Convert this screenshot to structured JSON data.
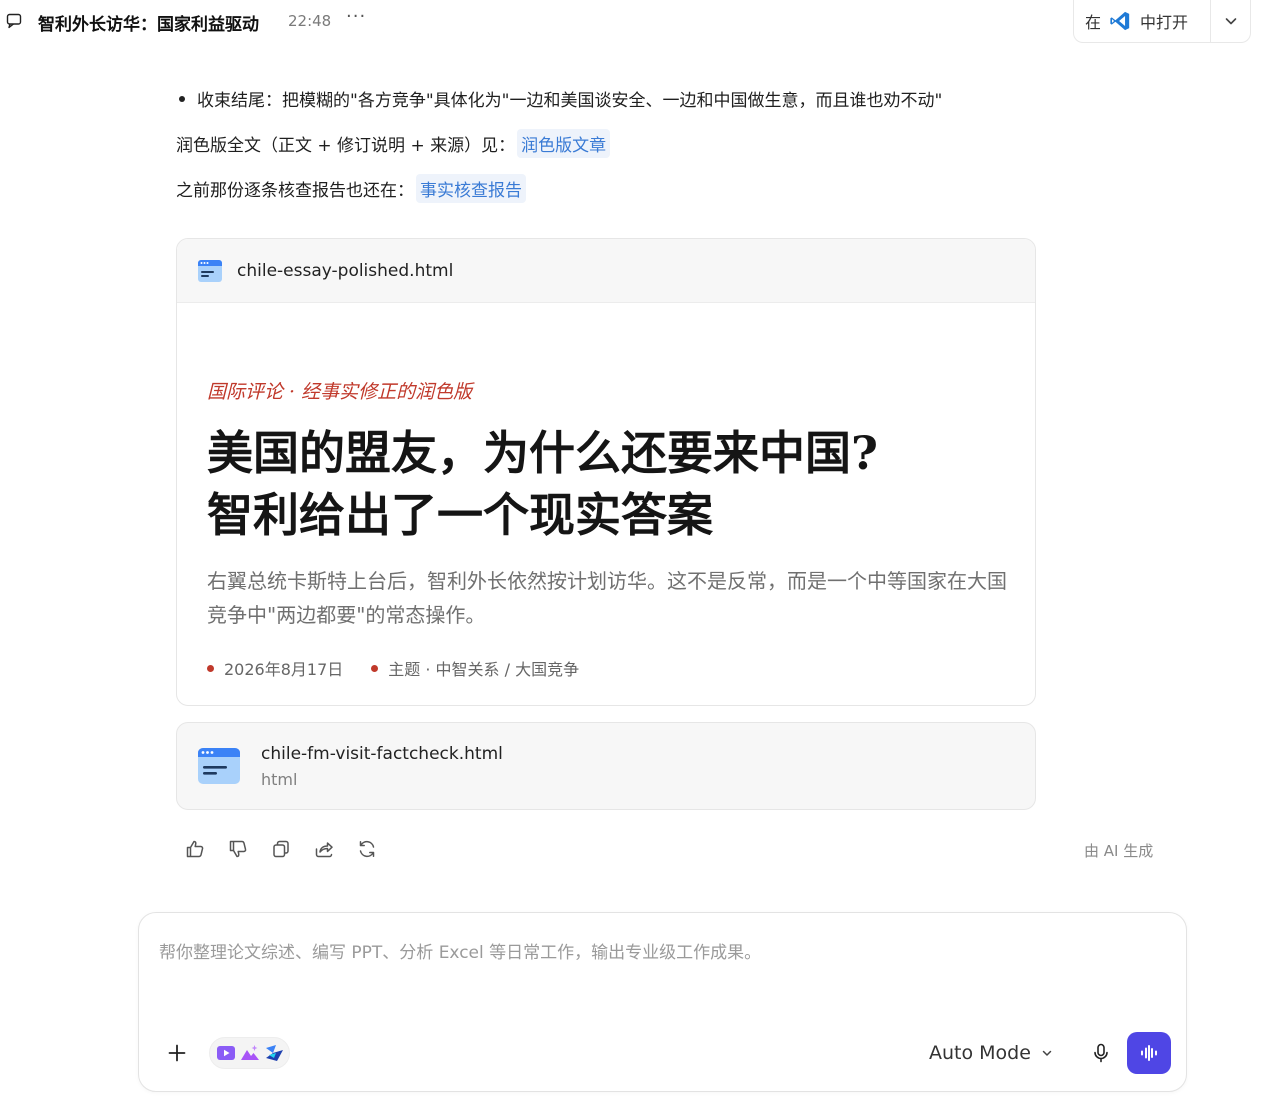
{
  "header": {
    "title": "智利外长访华：国家利益驱动",
    "time": "22:48",
    "more_label": "···",
    "open_prefix": "在",
    "open_suffix": "中打开",
    "open_app_icon": "vscode-icon"
  },
  "message": {
    "bullet": "收束结尾：把模糊的\"各方竞争\"具体化为\"一边和美国谈安全、一边和中国做生意，而且谁也劝不动\"",
    "ref1_text": "润色版全文（正文 + 修订说明 + 来源）见：",
    "ref1_link": "润色版文章",
    "ref2_text": "之前那份逐条核查报告也还在：",
    "ref2_link": "事实核查报告"
  },
  "card1": {
    "filename": "chile-essay-polished.html",
    "kicker": "国际评论 · 经事实修正的润色版",
    "headline_line1": "美国的盟友，为什么还要来中国?",
    "headline_line2": "智利给出了一个现实答案",
    "dek": "右翼总统卡斯特上台后，智利外长依然按计划访华。这不是反常，而是一个中等国家在大国竞争中\"两边都要\"的常态操作。",
    "meta_date": "2026年8月17日",
    "meta_topic": "主题 · 中智关系 / 大国竞争",
    "accent_color": "#c0392b"
  },
  "card2": {
    "filename": "chile-fm-visit-factcheck.html",
    "filetype": "html"
  },
  "actions": {
    "icons": [
      "thumbs-up-icon",
      "thumbs-down-icon",
      "copy-icon",
      "share-icon",
      "regenerate-icon"
    ],
    "ai_label": "由 AI 生成"
  },
  "composer": {
    "placeholder": "帮你整理论文综述、编写 PPT、分析 Excel 等日常工作，输出专业级工作成果。",
    "value": "",
    "mode_label": "Auto Mode",
    "send_color": "#4f46e5"
  }
}
